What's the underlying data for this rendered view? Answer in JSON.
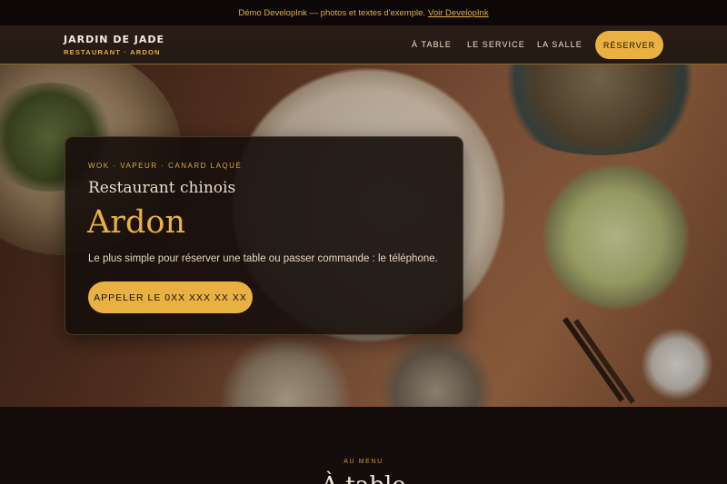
{
  "banner": {
    "text": "Démo DevelopInk — photos et textes d'exemple.",
    "link_label": "Voir DevelopInk"
  },
  "header": {
    "brand_name": "JARDIN DE JADE",
    "brand_sub": "RESTAURANT · ARDON",
    "nav": [
      {
        "label": "À TABLE"
      },
      {
        "label": "LE SERVICE"
      },
      {
        "label": "LA SALLE"
      }
    ],
    "reserve_label": "RÉSERVER"
  },
  "hero": {
    "eyebrow": "WOK · VAPEUR · CANARD LAQUÉ",
    "subtitle": "Restaurant chinois",
    "title": "Ardon",
    "lead": "Le plus simple pour réserver une table ou passer commande : le téléphone.",
    "call_label": "APPELER LE 0XX XXX XX XX"
  },
  "section": {
    "eyebrow": "AU MENU",
    "title": "À table"
  },
  "colors": {
    "accent": "#e8b142",
    "background": "#150d0b",
    "header": "#261a14"
  }
}
